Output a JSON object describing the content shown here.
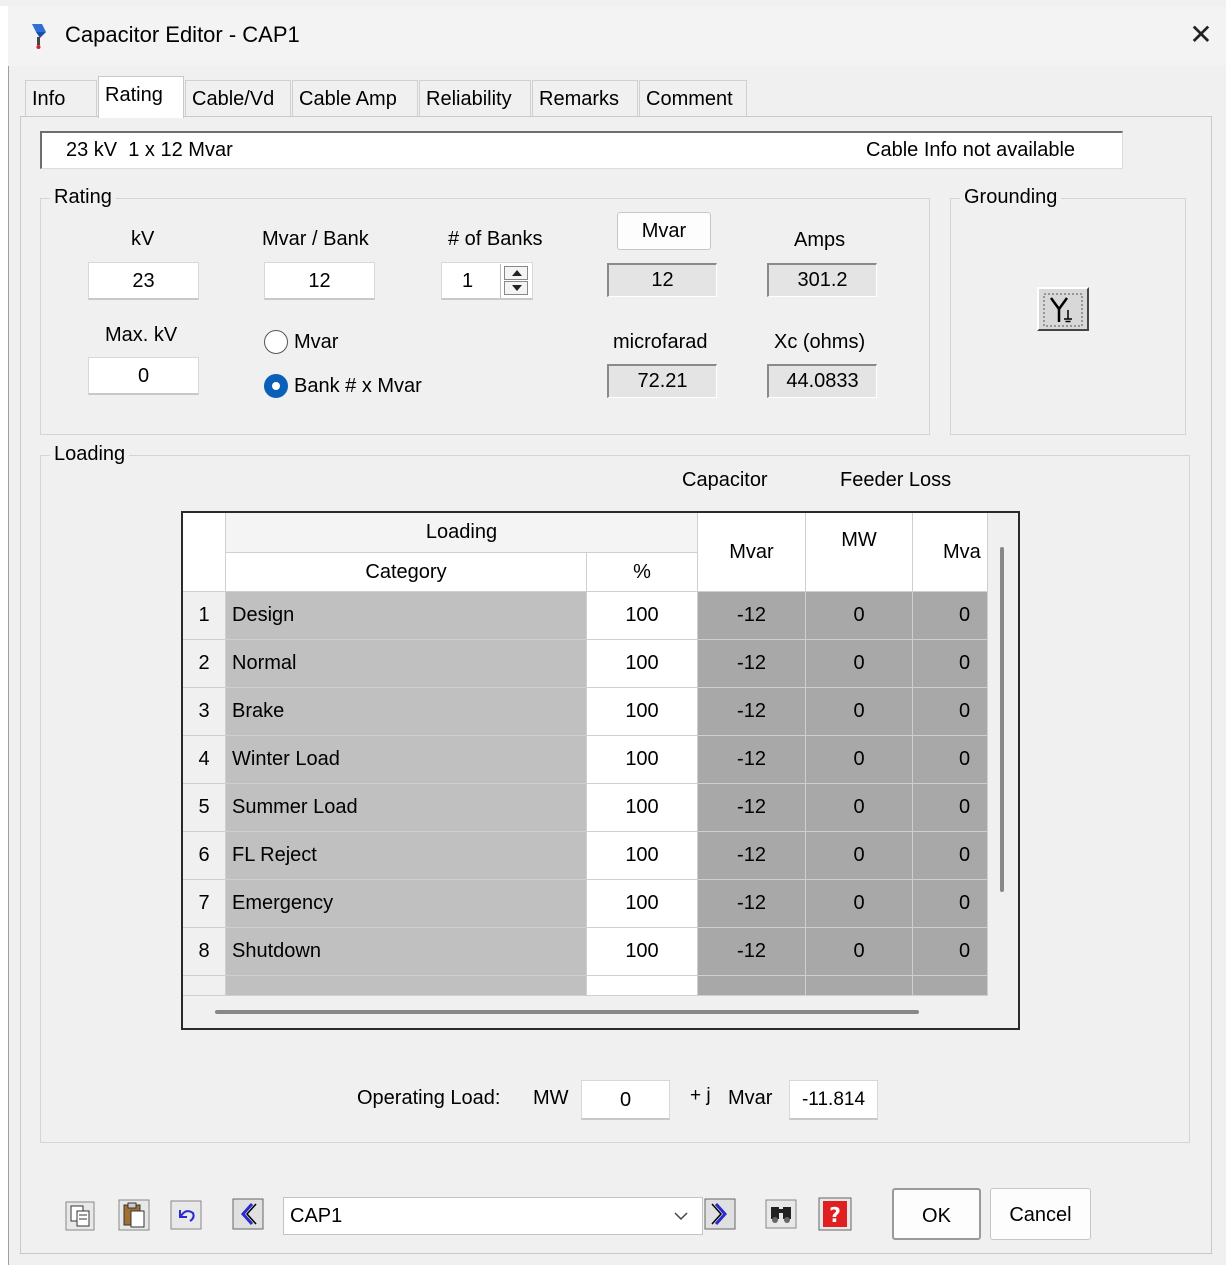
{
  "window": {
    "title": "Capacitor Editor - CAP1",
    "close_glyph": "✕"
  },
  "tabs": [
    {
      "label": "Info"
    },
    {
      "label": "Rating",
      "active": true
    },
    {
      "label": "Cable/Vd"
    },
    {
      "label": "Cable Amp"
    },
    {
      "label": "Reliability"
    },
    {
      "label": "Remarks"
    },
    {
      "label": "Comment"
    }
  ],
  "info_bar": {
    "summary": "23 kV  1 x 12 Mvar",
    "cable_status": "Cable Info not available"
  },
  "rating": {
    "group_title": "Rating",
    "kv_label": "kV",
    "kv_value": "23",
    "mvar_bank_label": "Mvar / Bank",
    "mvar_bank_value": "12",
    "banks_label": "# of Banks",
    "banks_value": "1",
    "mvar_button_label": "Mvar",
    "mvar_value": "12",
    "amps_label": "Amps",
    "amps_value": "301.2",
    "max_kv_label": "Max. kV",
    "max_kv_value": "0",
    "radio_mvar_label": "Mvar",
    "radio_bank_label": "Bank # x Mvar",
    "selected_mode": "Bank # x Mvar",
    "microfarad_label": "microfarad",
    "microfarad_value": "72.21",
    "xc_label": "Xc (ohms)",
    "xc_value": "44.0833"
  },
  "grounding": {
    "group_title": "Grounding",
    "icon": "wye-grounded-icon"
  },
  "loading": {
    "group_title": "Loading",
    "capacitor_header": "Capacitor",
    "feeder_loss_header": "Feeder Loss",
    "grid_loading_header": "Loading",
    "col_category": "Category",
    "col_percent": "%",
    "col_mvar": "Mvar",
    "col_mw": "MW",
    "col_mva": "Mva",
    "rows": [
      {
        "num": "1",
        "category": "Design",
        "percent": "100",
        "mvar": "-12",
        "mw": "0",
        "mva": "0"
      },
      {
        "num": "2",
        "category": "Normal",
        "percent": "100",
        "mvar": "-12",
        "mw": "0",
        "mva": "0"
      },
      {
        "num": "3",
        "category": "Brake",
        "percent": "100",
        "mvar": "-12",
        "mw": "0",
        "mva": "0"
      },
      {
        "num": "4",
        "category": "Winter Load",
        "percent": "100",
        "mvar": "-12",
        "mw": "0",
        "mva": "0"
      },
      {
        "num": "5",
        "category": "Summer Load",
        "percent": "100",
        "mvar": "-12",
        "mw": "0",
        "mva": "0"
      },
      {
        "num": "6",
        "category": "FL Reject",
        "percent": "100",
        "mvar": "-12",
        "mw": "0",
        "mva": "0"
      },
      {
        "num": "7",
        "category": "Emergency",
        "percent": "100",
        "mvar": "-12",
        "mw": "0",
        "mva": "0"
      },
      {
        "num": "8",
        "category": "Shutdown",
        "percent": "100",
        "mvar": "-12",
        "mw": "0",
        "mva": "0"
      }
    ],
    "operating_load_label": "Operating Load:",
    "mw_label": "MW",
    "mw_value": "0",
    "plus_j": "+ j",
    "mvar_label": "Mvar",
    "mvar_value": "-11.814"
  },
  "footer": {
    "element_select_value": "CAP1",
    "ok_label": "OK",
    "cancel_label": "Cancel",
    "icons": [
      "copy-icon",
      "paste-icon",
      "undo-icon",
      "previous-icon",
      "next-icon",
      "find-icon",
      "help-icon"
    ]
  },
  "colors": {
    "accent_blue": "#0a5fb8",
    "nav_arrow_blue": "#2a2ad0",
    "help_red": "#e02020",
    "grid_gray": "#c0c0c0",
    "grid_dark_gray": "#a8a8a8"
  }
}
